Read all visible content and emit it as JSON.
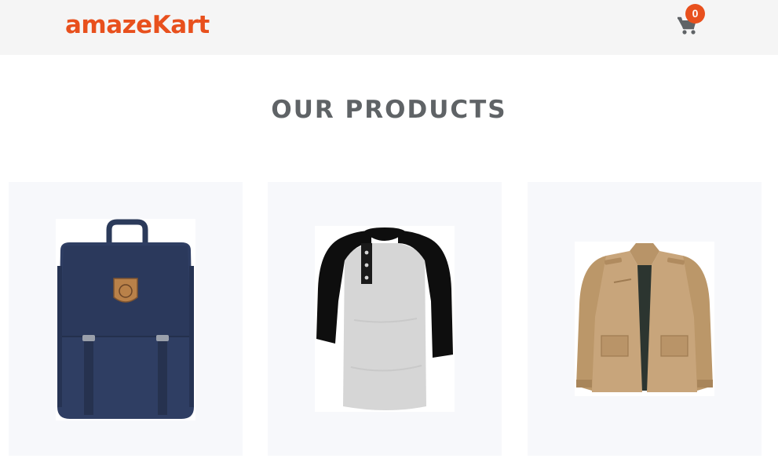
{
  "header": {
    "brand": "amazeKart",
    "cart_count": "0",
    "cart_icon": "shopping-cart-icon"
  },
  "main": {
    "title": "OUR PRODUCTS",
    "products": [
      {
        "image": "backpack-image"
      },
      {
        "image": "raglan-shirt-image"
      },
      {
        "image": "jacket-image"
      }
    ]
  },
  "colors": {
    "brand": "#e8501d",
    "badge": "#e8501d",
    "navbar_bg": "#f5f5f5",
    "card_bg": "#f7f8fb",
    "title_text": "#5f6366",
    "cart_icon": "#5f6366"
  }
}
